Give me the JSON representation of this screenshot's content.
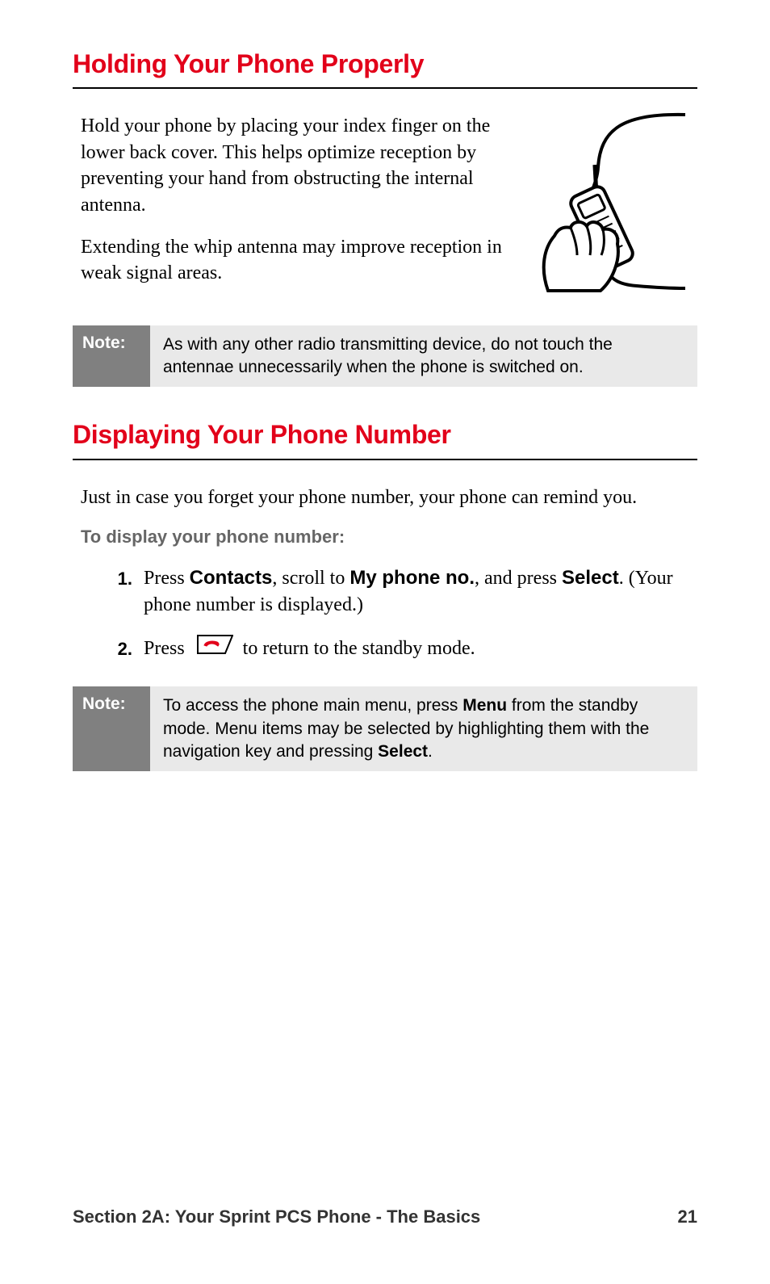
{
  "section1": {
    "heading": "Holding Your Phone Properly",
    "p1": "Hold your phone by placing your index finger on the lower back cover. This helps optimize reception by preventing your hand from obstructing the internal antenna.",
    "p2": "Extending the whip antenna may improve reception in weak signal areas.",
    "note_label": "Note:",
    "note_text": "As with any other radio transmitting device, do not touch the antennae unnecessarily when the phone is switched on."
  },
  "section2": {
    "heading": "Displaying Your Phone Number",
    "p1": "Just in case you forget your phone number, your phone can remind you.",
    "subheading": "To display your phone number:",
    "steps": {
      "s1": {
        "num": "1.",
        "t1": "Press ",
        "b1": "Contacts",
        "t2": ", scroll to ",
        "b2": "My phone no.",
        "t3": ", and press ",
        "b3": "Select",
        "t4": ". (Your phone number is displayed.)"
      },
      "s2": {
        "num": "2.",
        "t1": "Press ",
        "t2": " to return to the standby mode."
      }
    },
    "note_label": "Note:",
    "note": {
      "t1": "To access the phone main menu, press ",
      "b1": "Menu",
      "t2": " from the standby mode. Menu items may be selected by highlighting them with the navigation key and pressing ",
      "b2": "Select",
      "t3": "."
    }
  },
  "footer": {
    "left": "Section 2A: Your Sprint PCS Phone - The Basics",
    "right": "21"
  }
}
